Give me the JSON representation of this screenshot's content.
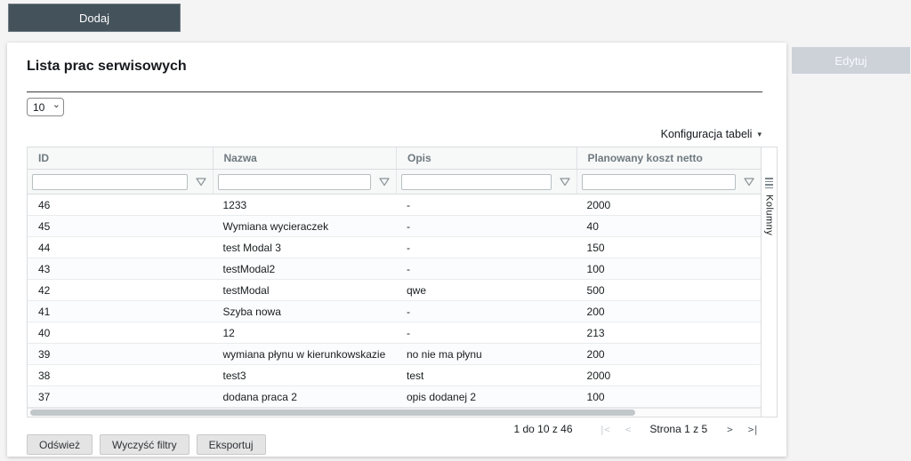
{
  "toolbar": {
    "add_label": "Dodaj"
  },
  "edit_button": {
    "label": "Edytuj"
  },
  "card": {
    "title": "Lista prac serwisowych",
    "page_size_selected": "10",
    "config_label": "Konfiguracja tabeli",
    "config_caret": "▾"
  },
  "table": {
    "columns": [
      {
        "key": "id",
        "label": "ID"
      },
      {
        "key": "nazwa",
        "label": "Nazwa"
      },
      {
        "key": "opis",
        "label": "Opis"
      },
      {
        "key": "koszt",
        "label": "Planowany koszt netto"
      }
    ],
    "filter_placeholder": "",
    "rows": [
      [
        "46",
        "1233",
        "-",
        "2000"
      ],
      [
        "45",
        "Wymiana wycieraczek",
        "-",
        "40"
      ],
      [
        "44",
        "test Modal 3",
        "-",
        "150"
      ],
      [
        "43",
        "testModal2",
        "-",
        "100"
      ],
      [
        "42",
        "testModal",
        "qwe",
        "500"
      ],
      [
        "41",
        "Szyba nowa",
        "-",
        "200"
      ],
      [
        "40",
        "12",
        "-",
        "213"
      ],
      [
        "39",
        "wymiana płynu w kierunkowskazie",
        "no nie ma płynu",
        "200"
      ],
      [
        "38",
        "test3",
        "test",
        "2000"
      ],
      [
        "37",
        "dodana praca 2",
        "opis dodanej 2",
        "100"
      ]
    ],
    "side_panel_label": "Kolumny"
  },
  "pagination": {
    "summary": "1 do 10 z 46",
    "first": "|<",
    "prev": "<",
    "page_label": "Strona 1 z 5",
    "next": ">",
    "last": ">|"
  },
  "footer": {
    "buttons": [
      {
        "key": "refresh",
        "label": "Odśwież"
      },
      {
        "key": "clear-filters",
        "label": "Wyczyść filtry"
      },
      {
        "key": "export",
        "label": "Eksportuj"
      }
    ]
  },
  "colors": {
    "accent_dark": "#44525b",
    "edit_disabled_bg": "#cdd2d9",
    "header_text": "#6f7a80",
    "border": "#d9dcde",
    "page_bg": "#f4f4f5"
  }
}
